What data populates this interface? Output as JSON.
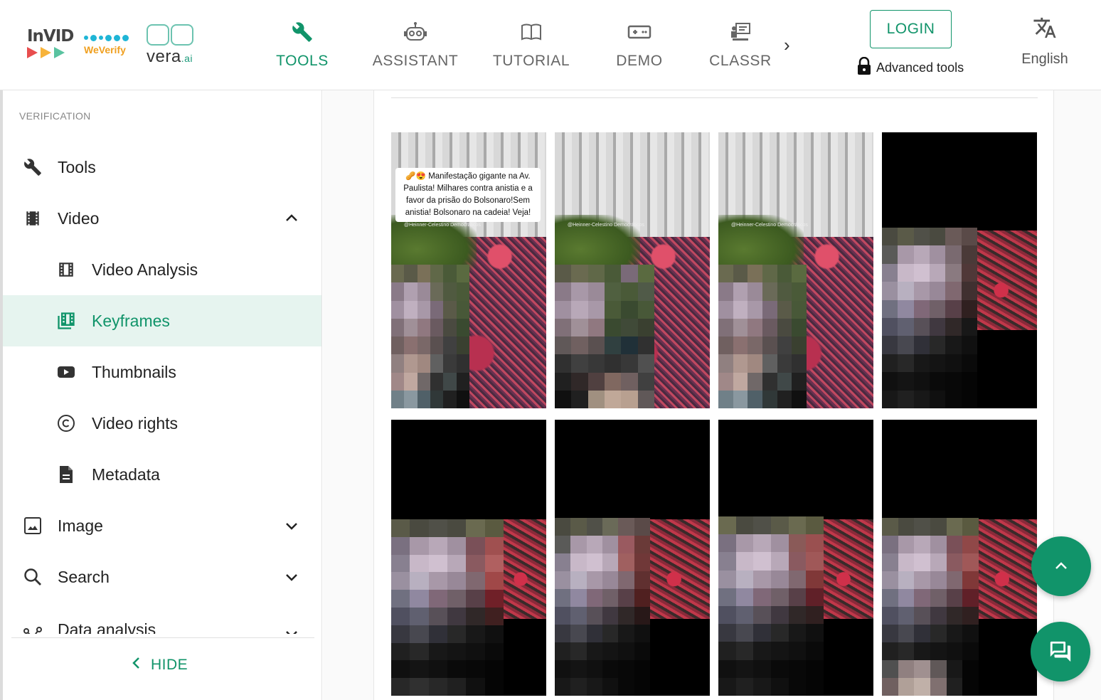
{
  "header": {
    "logos": {
      "invid": "InVID",
      "weverify": "WeVerify",
      "vera": "vera",
      "vera_suffix": ".ai"
    },
    "nav": [
      {
        "label": "TOOLS",
        "icon": "wrench-icon",
        "active": true
      },
      {
        "label": "ASSISTANT",
        "icon": "robot-icon",
        "active": false
      },
      {
        "label": "TUTORIAL",
        "icon": "book-icon",
        "active": false
      },
      {
        "label": "DEMO",
        "icon": "gamepad-icon",
        "active": false
      },
      {
        "label": "CLASSR",
        "icon": "classroom-icon",
        "active": false
      }
    ],
    "login_label": "LOGIN",
    "advanced_tools_label": "Advanced tools",
    "language_label": "English"
  },
  "sidebar": {
    "section_title": "VERIFICATION",
    "items": [
      {
        "label": "Tools",
        "icon": "wrench-icon"
      },
      {
        "label": "Video",
        "icon": "film-icon",
        "expanded": true
      },
      {
        "label": "Video Analysis",
        "icon": "film-strip-icon"
      },
      {
        "label": "Keyframes",
        "icon": "keyframes-icon",
        "selected": true
      },
      {
        "label": "Thumbnails",
        "icon": "youtube-icon"
      },
      {
        "label": "Video rights",
        "icon": "copyright-icon"
      },
      {
        "label": "Metadata",
        "icon": "document-icon"
      },
      {
        "label": "Image",
        "icon": "image-icon",
        "expanded": false
      },
      {
        "label": "Search",
        "icon": "search-icon",
        "expanded": false
      },
      {
        "label": "Data analysis",
        "icon": "graph-icon",
        "expanded": false
      }
    ],
    "hide_label": "HIDE"
  },
  "keyframes": {
    "caption": "🥜😍 Manifestação gigante na Av. Paulista! Milhares contra anistia e a favor da prisão do Bolsonaro!Sem anistia! Bolsonaro na cadeia! Veja!",
    "watermark": "@Heinner-Celestino Democráticos",
    "frame_count": 8
  },
  "colors": {
    "accent": "#11946a",
    "selected_bg": "#e6f4ef"
  }
}
